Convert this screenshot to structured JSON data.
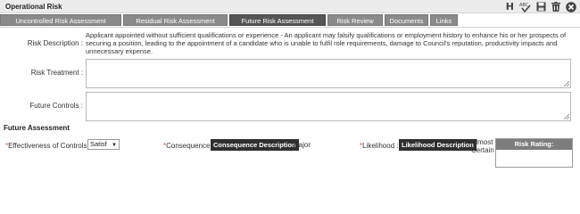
{
  "window": {
    "title": "Operational Risk",
    "help_letter": "H",
    "icons": [
      "spellcheck-icon",
      "save-icon",
      "delete-icon",
      "close-icon"
    ]
  },
  "tabs": [
    {
      "label": "Uncontrolled Risk Assessment",
      "active": false
    },
    {
      "label": "Residual Risk Assessment",
      "active": false
    },
    {
      "label": "Future Risk Assessment",
      "active": true
    },
    {
      "label": "Risk Review",
      "active": false
    },
    {
      "label": "Documents",
      "active": false
    },
    {
      "label": "Links",
      "active": false
    }
  ],
  "form": {
    "risk_description_label": "Risk Description :",
    "risk_description_text": "Applicant appointed without sufficient qualifications or experience - An applicant may falsify qualifications or employment history to enhance his or her prospects of securing a position, leading to the appointment of a candidate who is unable to fulfil role requirements, damage to Council's reputation, productivity impacts and unnecessary expense.",
    "risk_treatment_label": "Risk Treatment :",
    "risk_treatment_value": "",
    "future_controls_label": "Future Controls :",
    "future_controls_value": ""
  },
  "future_assessment": {
    "section_title": "Future Assessment",
    "required_marker": "*",
    "effectiveness_label": "Effectiveness of Controls :",
    "effectiveness_value": "Satisf",
    "consequence_label": "Consequence :",
    "consequence_button": "Consequence Description",
    "consequence_value": "Major",
    "likelihood_label": "Likelihood :",
    "likelihood_button": "Likelihood Description",
    "likelihood_value": "Almost Certain",
    "risk_rating_header": "Risk Rating:",
    "risk_rating_value": ""
  },
  "colors": {
    "tab_bg": "#8a8a8a",
    "tab_active_bg": "#555555",
    "dark_button": "#2f2f2f",
    "required": "#d9534f",
    "rating_header": "#7d7d7d"
  }
}
